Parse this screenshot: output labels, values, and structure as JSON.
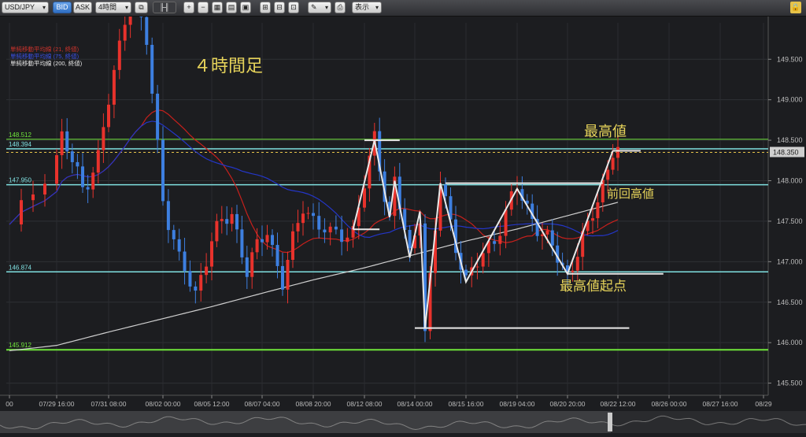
{
  "toolbar": {
    "symbol": "USD/JPY",
    "bid_label": "BID",
    "ask_label": "ASK",
    "timeframe": "4時間",
    "display_label": "表示"
  },
  "legend": {
    "ma21": "単純移動平均線 (21, 終値)",
    "ma_blue": "単純移動平均線 (75, 終値)",
    "ma200": "単純移動平均線 (200, 終値)"
  },
  "annotations": {
    "timeframe_title": "４時間足",
    "highest": "最高値",
    "previous_high": "前回高値",
    "highest_origin": "最高値起点"
  },
  "colors": {
    "up": "#e8322c",
    "down": "#3d7fe0",
    "ma21": "#c8201c",
    "ma_blue": "#2436c8",
    "ma200": "#cfcfcf",
    "annotation_text": "#e6d35a",
    "level_cyan": "#7fe0e0",
    "level_green": "#6fe53a",
    "price_tag": "#cfcfcf"
  },
  "chart_data": {
    "type": "candlestick",
    "ylim": [
      145.35,
      149.95
    ],
    "y_ticks": [
      "149.500",
      "149.000",
      "148.500",
      "148.000",
      "147.500",
      "147.000",
      "146.500",
      "146.000",
      "145.500"
    ],
    "x_ticks": [
      "00",
      "07/29 16:00",
      "07/31 08:00",
      "08/02 00:00",
      "08/05 12:00",
      "08/07 04:00",
      "08/08 20:00",
      "08/12 08:00",
      "08/14 00:00",
      "08/15 16:00",
      "08/19 04:00",
      "08/20 20:00",
      "08/22 12:00",
      "08/26 00:00",
      "08/27 16:00",
      "08/29"
    ],
    "current_price": "148.350",
    "levels": [
      {
        "value": 148.512,
        "label": "148.512",
        "color": "green"
      },
      {
        "value": 148.394,
        "label": "148.394",
        "color": "cyan"
      },
      {
        "value": 147.95,
        "label": "147.950",
        "color": "cyan"
      },
      {
        "value": 146.874,
        "label": "146.874",
        "color": "cyan"
      },
      {
        "value": 145.912,
        "label": "145.912",
        "color": "green"
      }
    ],
    "drawn_lines": [
      {
        "name": "highest-bar",
        "points": [
          [
            "08/12 08:00",
            148.5
          ],
          [
            "08/13 12:00",
            148.5
          ]
        ]
      },
      {
        "name": "left-base",
        "points": [
          [
            "08/12 00:00",
            147.4
          ],
          [
            "08/12 20:00",
            147.4
          ]
        ]
      },
      {
        "name": "prev-high-bar",
        "points": [
          [
            "08/15 00:00",
            147.97
          ],
          [
            "08/22 00:00",
            147.97
          ]
        ]
      },
      {
        "name": "low-bar",
        "points": [
          [
            "08/14 00:00",
            146.18
          ],
          [
            "08/22 20:00",
            146.18
          ]
        ]
      },
      {
        "name": "origin-bar",
        "points": [
          [
            "08/20 20:00",
            146.85
          ],
          [
            "08/23 20:00",
            146.85
          ]
        ]
      },
      {
        "name": "top-bar",
        "points": [
          [
            "08/22 08:00",
            148.37
          ],
          [
            "08/23 04:00",
            148.37
          ]
        ]
      },
      {
        "name": "zigzag",
        "points": [
          [
            "08/12 00:00",
            147.4
          ],
          [
            "08/12 16:00",
            148.5
          ],
          [
            "08/13 04:00",
            147.55
          ],
          [
            "08/13 08:00",
            148.0
          ],
          [
            "08/13 20:00",
            147.05
          ],
          [
            "08/14 04:00",
            147.62
          ],
          [
            "08/14 08:00",
            146.18
          ],
          [
            "08/14 20:00",
            147.97
          ],
          [
            "08/15 16:00",
            146.75
          ],
          [
            "08/19 04:00",
            147.9
          ],
          [
            "08/20 20:00",
            146.85
          ],
          [
            "08/22 08:00",
            148.37
          ]
        ]
      }
    ]
  }
}
